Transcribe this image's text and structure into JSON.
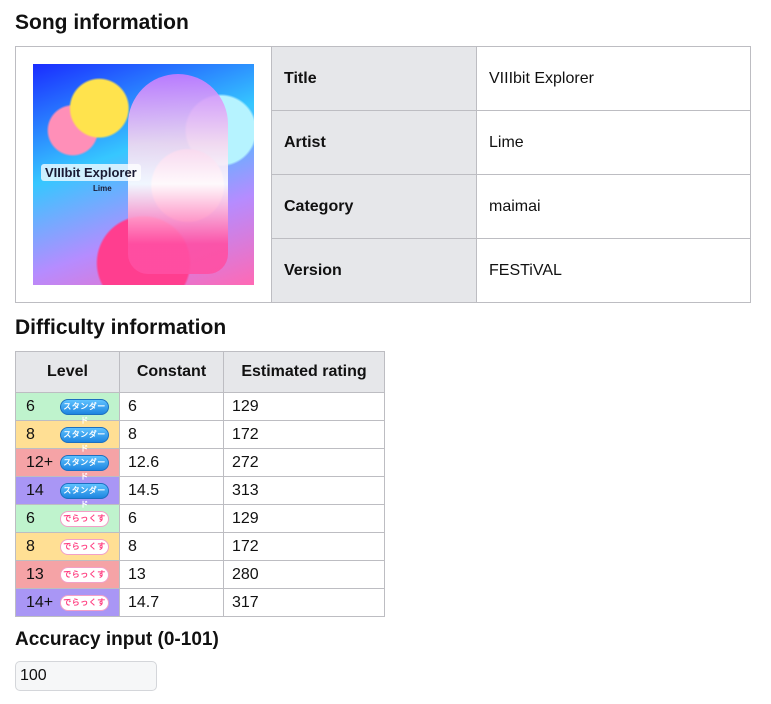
{
  "song_section": {
    "heading": "Song information",
    "jacket": {
      "title_text": "VIIIbit Explorer",
      "artist_text": "Lime"
    },
    "rows": [
      {
        "label": "Title",
        "value": "VIIIbit Explorer"
      },
      {
        "label": "Artist",
        "value": "Lime"
      },
      {
        "label": "Category",
        "value": "maimai"
      },
      {
        "label": "Version",
        "value": "FESTiVAL"
      }
    ]
  },
  "difficulty_section": {
    "heading": "Difficulty information",
    "columns": [
      "Level",
      "Constant",
      "Estimated rating"
    ],
    "rows": [
      {
        "level": "6",
        "chart": "standard",
        "badge": "スタンダード",
        "constant": "6",
        "rating": "129",
        "color": "#bff3cd"
      },
      {
        "level": "8",
        "chart": "standard",
        "badge": "スタンダード",
        "constant": "8",
        "rating": "172",
        "color": "#ffdf94"
      },
      {
        "level": "12+",
        "chart": "standard",
        "badge": "スタンダード",
        "constant": "12.6",
        "rating": "272",
        "color": "#f5a3a6"
      },
      {
        "level": "14",
        "chart": "standard",
        "badge": "スタンダード",
        "constant": "14.5",
        "rating": "313",
        "color": "#a996f5"
      },
      {
        "level": "6",
        "chart": "dx",
        "badge": "でらっくす",
        "constant": "6",
        "rating": "129",
        "color": "#bff3cd"
      },
      {
        "level": "8",
        "chart": "dx",
        "badge": "でらっくす",
        "constant": "8",
        "rating": "172",
        "color": "#ffdf94"
      },
      {
        "level": "13",
        "chart": "dx",
        "badge": "でらっくす",
        "constant": "13",
        "rating": "280",
        "color": "#f5a3a6"
      },
      {
        "level": "14+",
        "chart": "dx",
        "badge": "でらっくす",
        "constant": "14.7",
        "rating": "317",
        "color": "#a996f5"
      }
    ]
  },
  "accuracy_section": {
    "heading": "Accuracy input (0-101)",
    "input_value": "100"
  }
}
